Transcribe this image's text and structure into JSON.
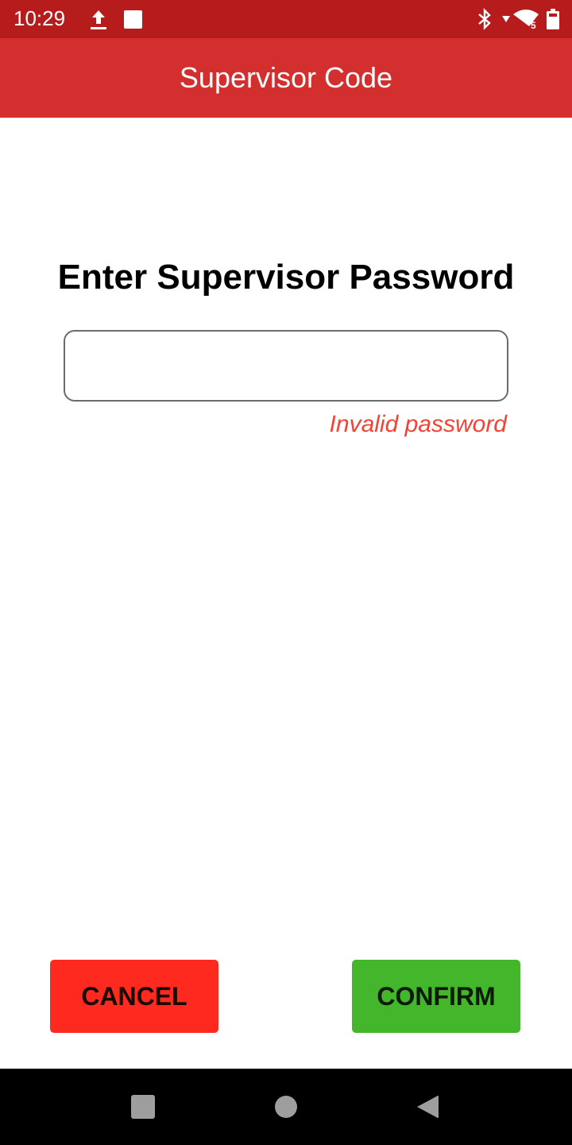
{
  "status_bar": {
    "time": "10:29",
    "icons": [
      "upload-icon",
      "notification-square-icon",
      "bluetooth-icon",
      "data-arrow-icon",
      "wifi-icon",
      "battery-icon"
    ],
    "wifi_badge": "5"
  },
  "app_bar": {
    "title": "Supervisor Code",
    "color": "#d32f2f"
  },
  "main": {
    "heading": "Enter Supervisor Password",
    "password_field": {
      "value": "",
      "placeholder": ""
    },
    "error_text": "Invalid password",
    "error_color": "#f44336"
  },
  "actions": {
    "cancel_label": "CANCEL",
    "cancel_color": "#ff2a1f",
    "confirm_label": "CONFIRM",
    "confirm_color": "#43b62b"
  },
  "nav_bar": {
    "buttons": [
      "recents",
      "home",
      "back"
    ]
  }
}
